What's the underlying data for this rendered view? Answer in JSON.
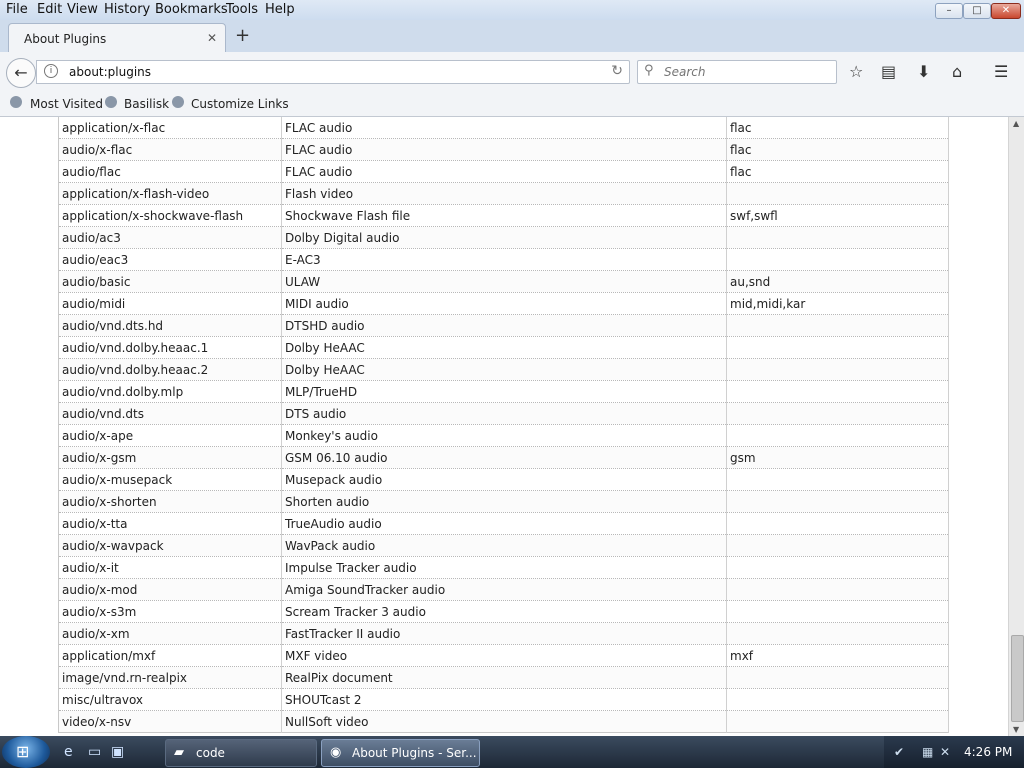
{
  "menu": [
    "File",
    "Edit",
    "View",
    "History",
    "Bookmarks",
    "Tools",
    "Help"
  ],
  "window_buttons": {
    "minimize": "–",
    "maximize": "□",
    "close": "✕"
  },
  "tab": {
    "title": "About Plugins",
    "close": "✕",
    "new_tab": "+"
  },
  "navbar": {
    "url": "about:plugins",
    "search_placeholder": "Search",
    "icons": [
      "back-icon",
      "info-icon",
      "reload-icon",
      "search-icon",
      "star-icon",
      "reading-list-icon",
      "download-icon",
      "home-icon",
      "menu-icon"
    ]
  },
  "bookmarks": [
    "Most Visited",
    "Basilisk",
    "Customize Links"
  ],
  "table": {
    "rows": [
      [
        "application/x-flac",
        "FLAC audio",
        "flac"
      ],
      [
        "audio/x-flac",
        "FLAC audio",
        "flac"
      ],
      [
        "audio/flac",
        "FLAC audio",
        "flac"
      ],
      [
        "application/x-flash-video",
        "Flash video",
        ""
      ],
      [
        "application/x-shockwave-flash",
        "Shockwave Flash file",
        "swf,swfl"
      ],
      [
        "audio/ac3",
        "Dolby Digital audio",
        ""
      ],
      [
        "audio/eac3",
        "E-AC3",
        ""
      ],
      [
        "audio/basic",
        "ULAW",
        "au,snd"
      ],
      [
        "audio/midi",
        "MIDI audio",
        "mid,midi,kar"
      ],
      [
        "audio/vnd.dts.hd",
        "DTSHD audio",
        ""
      ],
      [
        "audio/vnd.dolby.heaac.1",
        "Dolby HeAAC",
        ""
      ],
      [
        "audio/vnd.dolby.heaac.2",
        "Dolby HeAAC",
        ""
      ],
      [
        "audio/vnd.dolby.mlp",
        "MLP/TrueHD",
        ""
      ],
      [
        "audio/vnd.dts",
        "DTS audio",
        ""
      ],
      [
        "audio/x-ape",
        "Monkey's audio",
        ""
      ],
      [
        "audio/x-gsm",
        "GSM 06.10 audio",
        "gsm"
      ],
      [
        "audio/x-musepack",
        "Musepack audio",
        ""
      ],
      [
        "audio/x-shorten",
        "Shorten audio",
        ""
      ],
      [
        "audio/x-tta",
        "TrueAudio audio",
        ""
      ],
      [
        "audio/x-wavpack",
        "WavPack audio",
        ""
      ],
      [
        "audio/x-it",
        "Impulse Tracker audio",
        ""
      ],
      [
        "audio/x-mod",
        "Amiga SoundTracker audio",
        ""
      ],
      [
        "audio/x-s3m",
        "Scream Tracker 3 audio",
        ""
      ],
      [
        "audio/x-xm",
        "FastTracker II audio",
        ""
      ],
      [
        "application/mxf",
        "MXF video",
        "mxf"
      ],
      [
        "image/vnd.rn-realpix",
        "RealPix document",
        ""
      ],
      [
        "misc/ultravox",
        "SHOUTcast 2",
        ""
      ],
      [
        "video/x-nsv",
        "NullSoft video",
        ""
      ]
    ]
  },
  "taskbar": {
    "tasks": [
      {
        "label": "code",
        "icon": "folder-icon"
      },
      {
        "label": "About Plugins - Ser...",
        "icon": "browser-icon"
      }
    ],
    "clock": "4:26 PM"
  }
}
